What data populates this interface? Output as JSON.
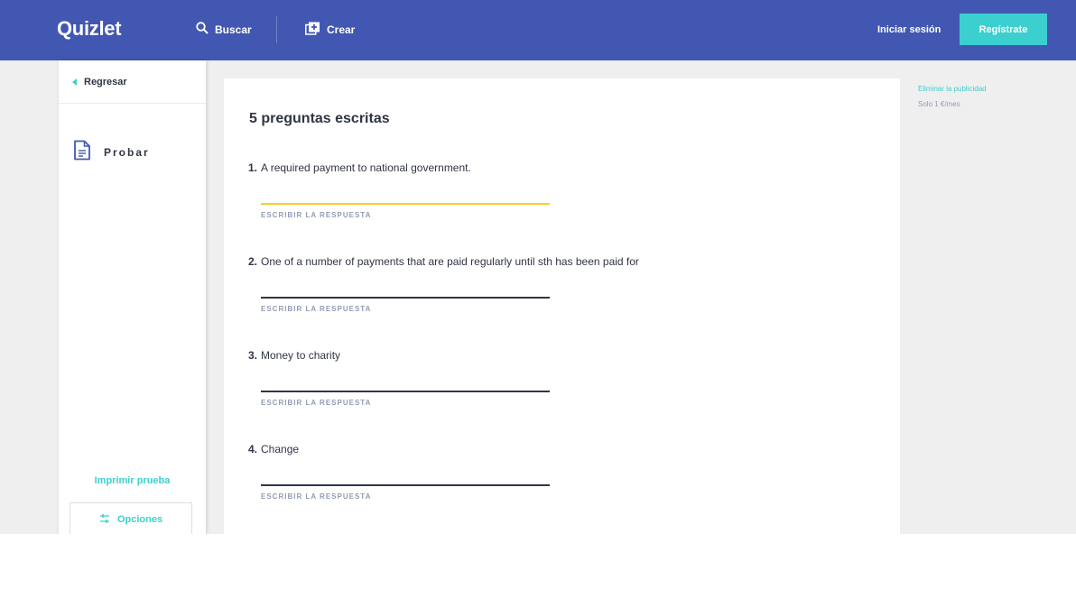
{
  "header": {
    "logo": "Quizlet",
    "search_label": "Buscar",
    "create_label": "Crear",
    "login_label": "Iniciar sesión",
    "signup_label": "Regístrate"
  },
  "sidebar": {
    "back_label": "Regresar",
    "mode_label": "Probar",
    "print_label": "Imprimir prueba",
    "options_label": "Opciones"
  },
  "test": {
    "title": "5 preguntas escritas",
    "answer_label": "ESCRIBIR LA RESPUESTA",
    "questions": [
      {
        "number": "1.",
        "text": "A required payment to national government."
      },
      {
        "number": "2.",
        "text": "One of a number of payments that are paid regularly until sth has been paid for"
      },
      {
        "number": "3.",
        "text": "Money to charity"
      },
      {
        "number": "4.",
        "text": "Change"
      }
    ]
  },
  "ad": {
    "remove_label": "Eliminar la publicidad",
    "price_label": "Solo 1 €/mes"
  },
  "colors": {
    "brand": "#4257b2",
    "accent": "#3ccfcf",
    "active_input": "#ffcd1f"
  }
}
